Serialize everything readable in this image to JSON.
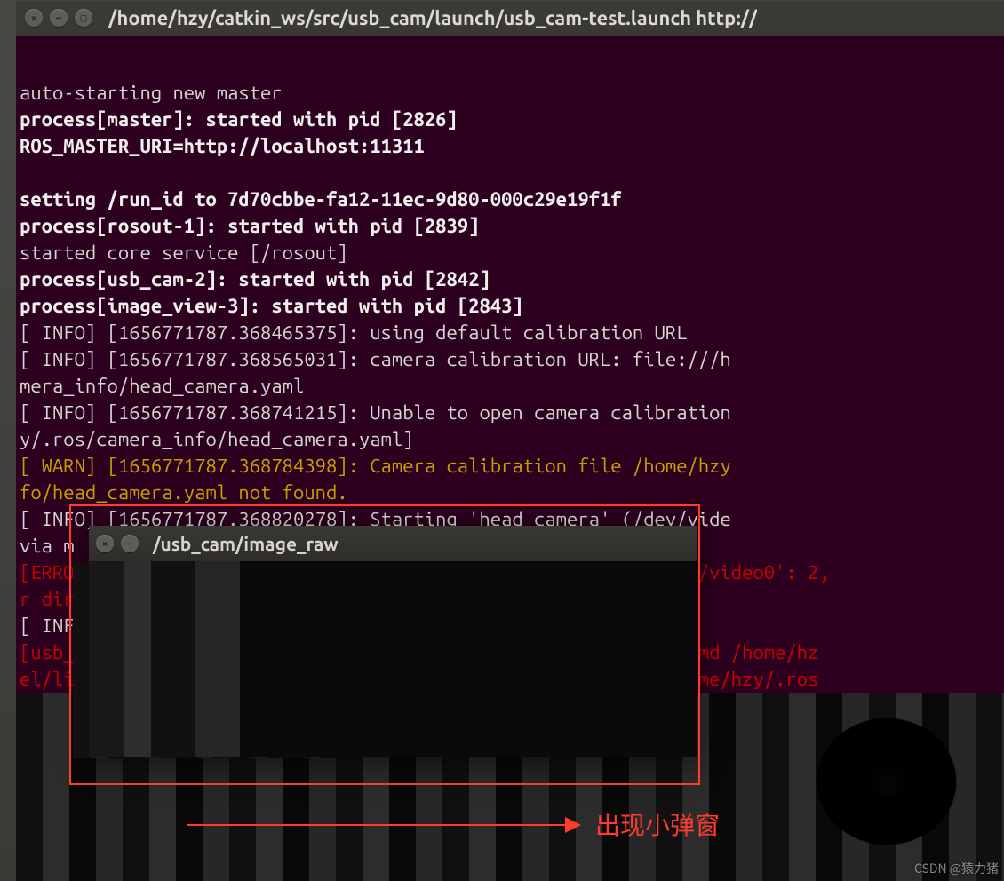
{
  "terminal": {
    "title": "/home/hzy/catkin_ws/src/usb_cam/launch/usb_cam-test.launch http://",
    "lines": [
      {
        "text": "",
        "cls": ""
      },
      {
        "text": "auto-starting new master",
        "cls": "dim"
      },
      {
        "text": "process[master]: started with pid [2826]",
        "cls": "bold"
      },
      {
        "text": "ROS_MASTER_URI=http://localhost:11311",
        "cls": "bold"
      },
      {
        "text": "",
        "cls": ""
      },
      {
        "text": "setting /run_id to 7d70cbbe-fa12-11ec-9d80-000c29e19f1f",
        "cls": "bold"
      },
      {
        "text": "process[rosout-1]: started with pid [2839]",
        "cls": "bold"
      },
      {
        "text": "started core service [/rosout]",
        "cls": "dim"
      },
      {
        "text": "process[usb_cam-2]: started with pid [2842]",
        "cls": "bold"
      },
      {
        "text": "process[image_view-3]: started with pid [2843]",
        "cls": "bold"
      },
      {
        "text": "[ INFO] [1656771787.368465375]: using default calibration URL",
        "cls": "dim"
      },
      {
        "text": "[ INFO] [1656771787.368565031]: camera calibration URL: file:///h",
        "cls": "dim"
      },
      {
        "text": "mera_info/head_camera.yaml",
        "cls": "dim"
      },
      {
        "text": "[ INFO] [1656771787.368741215]: Unable to open camera calibration",
        "cls": "dim"
      },
      {
        "text": "y/.ros/camera_info/head_camera.yaml]",
        "cls": "dim"
      },
      {
        "text": "[ WARN] [1656771787.368784398]: Camera calibration file /home/hzy",
        "cls": "warn"
      },
      {
        "text": "fo/head_camera.yaml not found.",
        "cls": "warn"
      },
      {
        "text": "[ INFO] [1656771787.368820278]: Starting 'head_camera' (/dev/vide",
        "cls": "dim"
      },
      {
        "text": "via m",
        "cls": "dim"
      },
      {
        "text": "[ERRO                                                 fy '/dev/video0': 2,",
        "cls": "err"
      },
      {
        "text": "r dir",
        "cls": "err"
      },
      {
        "text": "[ INF                                                 rt \"raw\"",
        "cls": "dim"
      },
      {
        "text": "[usb_                                                 ode 1, cmd /home/hz",
        "cls": "err"
      },
      {
        "text": "el/li                                                 log:=/home/hzy/.ros",
        "cls": "err"
      }
    ]
  },
  "popup": {
    "title": "/usb_cam/image_raw"
  },
  "annotation": {
    "label": "出现小弹窗"
  },
  "watermark": "CSDN @猿力猪"
}
